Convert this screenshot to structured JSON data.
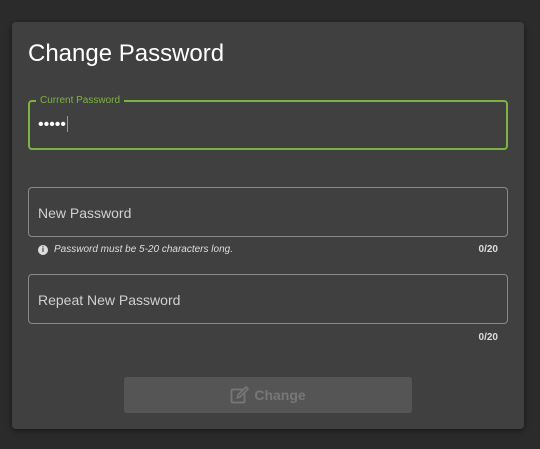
{
  "dialog": {
    "title": "Change Password"
  },
  "fields": {
    "current": {
      "label": "Current Password",
      "value": "•••••"
    },
    "new": {
      "placeholder": "New Password",
      "hint": "Password must be 5-20 characters long.",
      "counter": "0/20"
    },
    "repeat": {
      "placeholder": "Repeat New Password",
      "counter": "0/20"
    }
  },
  "actions": {
    "change_label": "Change",
    "change_icon": "edit-icon",
    "change_disabled": true
  },
  "colors": {
    "accent": "#7cb342",
    "background": "#2b2b2b",
    "card": "#404040"
  }
}
